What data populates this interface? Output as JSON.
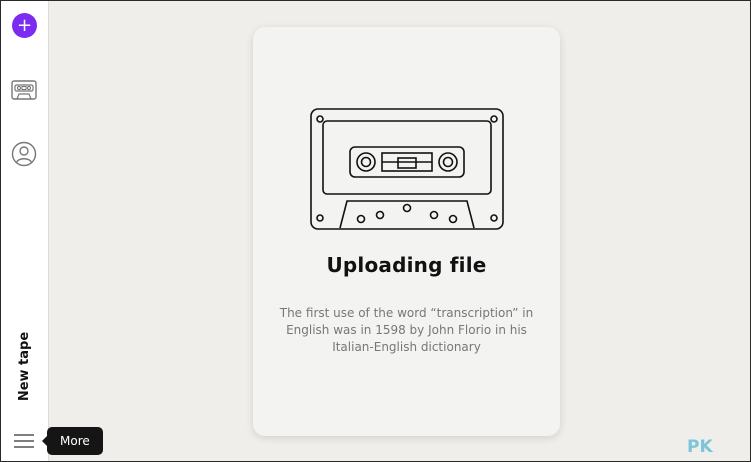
{
  "sidebar": {
    "add_icon": "plus-icon",
    "nav_icons": [
      "cassette-icon",
      "user-profile-icon"
    ],
    "new_tape_label": "New tape",
    "menu_icon": "hamburger-menu-icon"
  },
  "tooltip": {
    "label": "More"
  },
  "upload_card": {
    "illustration": "cassette-tape-illustration",
    "title": "Uploading file",
    "fact": "The first use of the word “transcription” in English was in 1598 by John Florio in his Italian-English dictionary"
  },
  "watermark": {
    "text": "PK"
  },
  "colors": {
    "accent": "#7b2cf0",
    "background": "#efeeea",
    "card": "#f3f3f1",
    "tooltip": "#151515",
    "watermark": "#7cc4d9"
  }
}
